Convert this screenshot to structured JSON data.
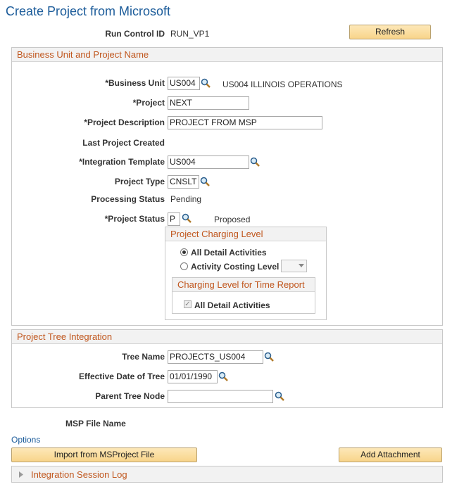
{
  "page": {
    "title": "Create Project from Microsoft"
  },
  "run_control": {
    "label": "Run Control ID",
    "value": "RUN_VP1"
  },
  "refresh_button": "Refresh",
  "business_unit_section": {
    "header": "Business Unit and Project Name",
    "business_unit": {
      "label": "*Business Unit",
      "value": "US004",
      "description": "US004 ILLINOIS OPERATIONS"
    },
    "project": {
      "label": "*Project",
      "value": "NEXT"
    },
    "project_description": {
      "label": "*Project Description",
      "value": "PROJECT FROM MSP"
    },
    "last_project_created": {
      "label": "Last Project Created"
    },
    "integration_template": {
      "label": "*Integration Template",
      "value": "US004"
    },
    "project_type": {
      "label": "Project Type",
      "value": "CNSLT"
    },
    "processing_status": {
      "label": "Processing Status",
      "value": "Pending"
    },
    "project_status": {
      "label": "*Project Status",
      "value": "P",
      "description": "Proposed"
    }
  },
  "charging_level": {
    "header": "Project Charging Level",
    "options": [
      "All Detail Activities",
      "Activity Costing Level"
    ],
    "selected": "All Detail Activities",
    "time_report": {
      "header": "Charging Level for Time Report",
      "checkbox_label": "All Detail Activities",
      "checked": true
    }
  },
  "tree_section": {
    "header": "Project Tree Integration",
    "tree_name": {
      "label": "Tree Name",
      "value": "PROJECTS_US004"
    },
    "effective_date": {
      "label": "Effective Date of Tree",
      "value": "01/01/1990"
    },
    "parent_tree_node": {
      "label": "Parent Tree Node",
      "value": ""
    }
  },
  "msp_file_name": {
    "label": "MSP File Name"
  },
  "options_link": "Options",
  "import_button": "Import from MSProject File",
  "attachment_button": "Add Attachment",
  "session_log": {
    "label": "Integration Session Log"
  },
  "colors": {
    "title": "#1c5c9a",
    "section_header": "#c0561d",
    "button": "#f8d48a"
  }
}
